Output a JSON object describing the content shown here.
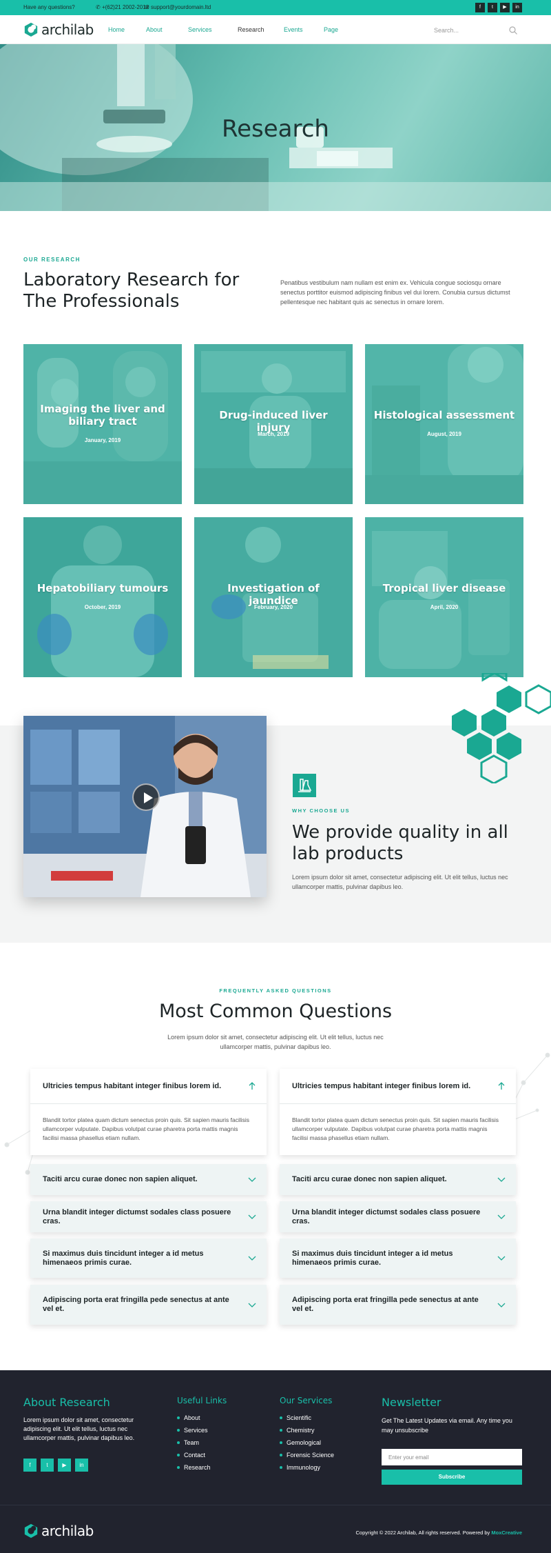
{
  "topbar": {
    "question": "Have any questions?",
    "phone": "+(62)21 2002-2012",
    "email": "support@yourdomain.ltd",
    "socials": [
      "facebook-icon",
      "twitter-icon",
      "youtube-icon",
      "linkedin-icon"
    ]
  },
  "header": {
    "logo": "archilab",
    "nav": [
      "Home",
      "About",
      "Services",
      "Research",
      "Events",
      "Page"
    ],
    "search_placeholder": "Search..."
  },
  "hero": {
    "title": "Research"
  },
  "research": {
    "eyebrow": "OUR RESEARCH",
    "title_line1": "Laboratory Research for",
    "title_line2": "The Professionals",
    "text": "Penatibus vestibulum nam nullam est enim ex. Vehicula congue sociosqu ornare senectus porttitor euismod adipiscing finibus vel dui lorem. Conubia cursus dictumst pellentesque nec habitant quis ac senectus in ornare lorem.",
    "cards": [
      {
        "title": "Imaging the liver and biliary tract",
        "date": "January, 2019"
      },
      {
        "title": "Drug-induced liver injury",
        "date": "March, 2019"
      },
      {
        "title": "Histological assessment",
        "date": "August, 2019"
      },
      {
        "title": "Hepatobiliary tumours",
        "date": "October, 2019"
      },
      {
        "title": "Investigation of jaundice",
        "date": "February, 2020"
      },
      {
        "title": "Tropical liver disease",
        "date": "April, 2020"
      }
    ]
  },
  "quality": {
    "eyebrow": "WHY CHOOSE US",
    "title_line1": "We provide quality in all",
    "title_line2": "lab products",
    "text": "Lorem ipsum dolor sit amet, consectetur adipiscing elit. Ut elit tellus, luctus nec ullamcorper mattis, pulvinar dapibus leo."
  },
  "faq": {
    "eyebrow": "FREQUENTLY ASKED QUESTIONS",
    "title": "Most Common Questions",
    "text_line1": "Lorem ipsum dolor sit amet, consectetur adipiscing elit. Ut elit tellus, luctus nec",
    "text_line2": "ullamcorper mattis, pulvinar dapibus leo.",
    "open_question": "Ultricies tempus habitant integer finibus lorem id.",
    "open_answer": "Blandit tortor platea quam dictum senectus proin quis. Sit sapien mauris facilisis ullamcorper vulputate. Dapibus volutpat curae pharetra porta mattis magnis facilisi massa phasellus etiam nullam.",
    "questions": [
      "Taciti arcu curae donec non sapien aliquet.",
      "Urna blandit integer dictumst sodales class posuere cras.",
      "Si maximus duis tincidunt integer a id metus himenaeos primis curae.",
      "Adipiscing porta erat fringilla pede senectus at ante vel et."
    ]
  },
  "footer": {
    "about_title": "About Research",
    "about_text": "Lorem ipsum dolor sit amet, consectetur adipiscing elit. Ut elit tellus, luctus nec ullamcorper mattis, pulvinar dapibus leo.",
    "links_title": "Useful Links",
    "links": [
      "About",
      "Services",
      "Team",
      "Contact",
      "Research"
    ],
    "services_title": "Our Services",
    "services": [
      "Scientific",
      "Chemistry",
      "Gemological",
      "Forensic Science",
      "Immunology"
    ],
    "newsletter_title": "Newsletter",
    "newsletter_text": "Get The Latest Updates via email. Any time you may unsubscribe",
    "email_placeholder": "Enter your email",
    "subscribe": "Subscribe",
    "logo": "archilab",
    "copyright": "Copyright © 2022 Archilab, All rights reserved. Powered by ",
    "powered_by": "MoxCreative"
  },
  "colors": {
    "accent": "#19bfa9",
    "dark": "#21232e"
  }
}
